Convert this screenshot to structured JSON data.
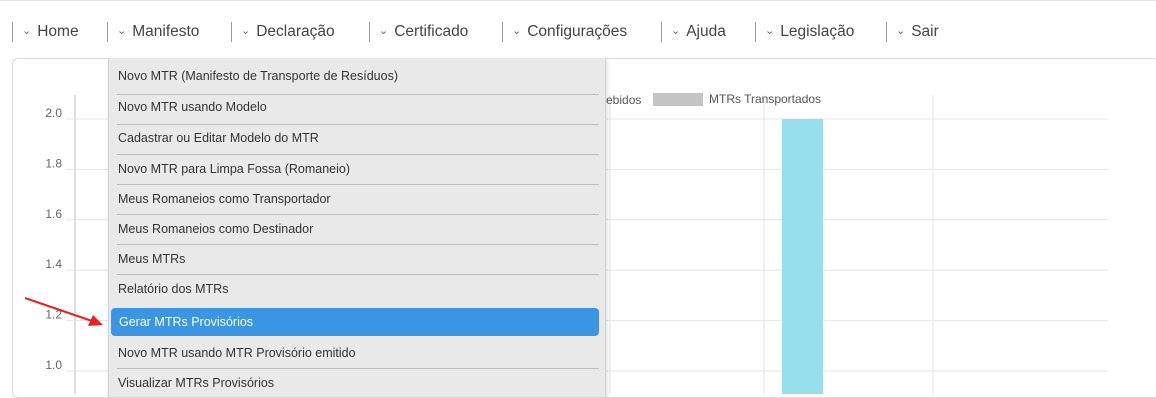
{
  "nav": {
    "items": [
      {
        "label": "Home"
      },
      {
        "label": "Manifesto"
      },
      {
        "label": "Declaração"
      },
      {
        "label": "Certificado"
      },
      {
        "label": "Configurações"
      },
      {
        "label": "Ajuda"
      },
      {
        "label": "Legislação"
      },
      {
        "label": "Sair"
      }
    ],
    "chevron": "⌄"
  },
  "chart_data": {
    "type": "bar",
    "legend": [
      "ebidos",
      "MTRs Transportados"
    ],
    "y_ticks": [
      "2.0",
      "1.8",
      "1.6",
      "1.4",
      "1.2",
      "1.0"
    ],
    "ylim": [
      1.0,
      2.0
    ],
    "grid": true,
    "series": [
      {
        "name": "MTRs Transportados",
        "color": "#96dfec",
        "values": [
          2.0
        ]
      }
    ]
  },
  "menu": {
    "items": [
      {
        "label": "Novo MTR (Manifesto de Transporte de Resíduos)"
      },
      {
        "label": "Novo MTR usando Modelo"
      },
      {
        "label": "Cadastrar ou Editar Modelo do MTR"
      },
      {
        "label": "Novo MTR para Limpa Fossa (Romaneio)"
      },
      {
        "label": "Meus Romaneios como Transportador"
      },
      {
        "label": "Meus Romaneios como Destinador"
      },
      {
        "label": "Meus MTRs"
      },
      {
        "label": "Relatório dos MTRs"
      },
      {
        "label": "Gerar MTRs Provisórios"
      },
      {
        "label": "Novo MTR usando MTR Provisório emitido"
      },
      {
        "label": "Visualizar MTRs Provisórios"
      }
    ],
    "active_index": 8
  },
  "colors": {
    "accent": "#3a95e4",
    "arrow": "#e8231f",
    "bar": "#96dfec"
  }
}
